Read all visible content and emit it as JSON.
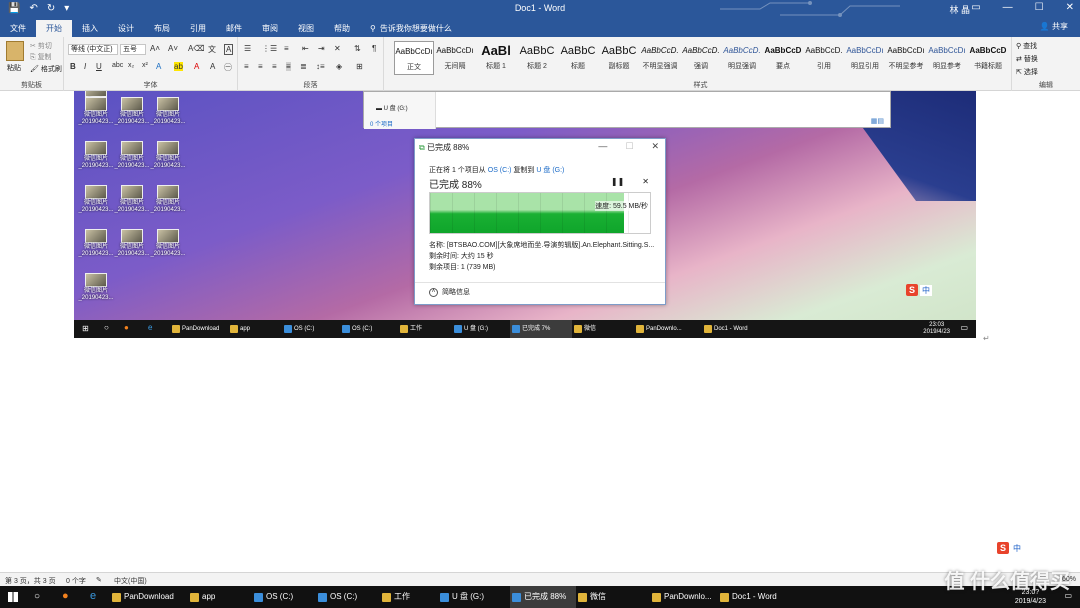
{
  "window": {
    "doc_title": "Doc1 - Word",
    "user": "林 晶",
    "share_label": "共享",
    "tell_me_placeholder": "告诉我你想要做什么"
  },
  "tabs": [
    "文件",
    "开始",
    "插入",
    "设计",
    "布局",
    "引用",
    "邮件",
    "审阅",
    "视图",
    "帮助"
  ],
  "ribbon": {
    "clipboard": {
      "paste": "粘贴",
      "cut": "剪切",
      "copy": "复制",
      "format_painter": "格式刷",
      "label": "剪贴板"
    },
    "font": {
      "name": "等线 (中文正)",
      "size": "五号",
      "label": "字体"
    },
    "paragraph": {
      "label": "段落"
    },
    "styles": {
      "label": "样式",
      "items": [
        {
          "sample": "AaBbCcDı",
          "name": "正文"
        },
        {
          "sample": "AaBbCcDı",
          "name": "无间隔"
        },
        {
          "sample": "AaBl",
          "name": "标题 1"
        },
        {
          "sample": "AaBbC",
          "name": "标题 2"
        },
        {
          "sample": "AaBbC",
          "name": "标题"
        },
        {
          "sample": "AaBbC",
          "name": "副标题"
        },
        {
          "sample": "AaBbCcD.",
          "name": "不明显强调"
        },
        {
          "sample": "AaBbCcD.",
          "name": "强调"
        },
        {
          "sample": "AaBbCcD.",
          "name": "明显强调"
        },
        {
          "sample": "AaBbCcD",
          "name": "要点"
        },
        {
          "sample": "AaBbCcD.",
          "name": "引用"
        },
        {
          "sample": "AaBbCcDı",
          "name": "明显引用"
        },
        {
          "sample": "AaBbCcDı",
          "name": "不明显参考"
        },
        {
          "sample": "AaBbCcDı",
          "name": "明显参考"
        },
        {
          "sample": "AaBbCcD",
          "name": "书籍标题"
        }
      ]
    },
    "editing": {
      "find": "查找",
      "replace": "替换",
      "select": "选择",
      "label": "编辑"
    }
  },
  "screenshot": {
    "desktop_icons": [
      "Sports",
      "微信图片_20190423...",
      "微信图片_20190423...",
      "微信图片_20190423...",
      "微信图片_20190423...",
      "微信图片_20190423...",
      "微信图片_20190423...",
      "微信图片_20190423...",
      "微信图片_20190423...",
      "微信图片_20190423...",
      "微信图片_20190423...",
      "微信图片_20190423...",
      "微信图片_20190423...",
      "微信图片_20190423..."
    ],
    "explorer": {
      "drive": "U 盘 (G:)",
      "count": "0 个项目"
    },
    "copy_dialog": {
      "title": "已完成 88%",
      "line_prefix": "正在将 1 个项目从",
      "source": "OS (C:)",
      "line_mid": "复制到",
      "dest": "U 盘 (G:)",
      "progress_text": "已完成 88%",
      "progress": 0.88,
      "speed": "速度: 59.5 MB/秒",
      "name": "名称: [BTSBAO.COM][大象席地而坐.导演剪辑版].An.Elephant.Sitting.S...",
      "remaining_time": "剩余时间: 大约 15 秒",
      "remaining_items": "剩余项目: 1 (739 MB)",
      "less_info": "简略信息"
    },
    "ime": {
      "s": "S",
      "c": "中"
    },
    "taskbar": {
      "items": [
        "PanDownload",
        "app",
        "OS (C:)",
        "OS (C:)",
        "工作",
        "U 盘 (G:)",
        "已完成 7%",
        "微信",
        "PanDownlo...",
        "Doc1 - Word"
      ],
      "time": "23:03",
      "date": "2019/4/23"
    }
  },
  "statusbar": {
    "pages": "第 3 页，共 3 页",
    "words": "0 个字",
    "lang": "中文(中国)",
    "zoom": "60%"
  },
  "taskbar": {
    "items": [
      "PanDownload",
      "app",
      "OS (C:)",
      "OS (C:)",
      "工作",
      "U 盘 (G:)",
      "已完成 88%",
      "微信",
      "PanDownlo...",
      "Doc1 - Word"
    ],
    "time": "23:0?",
    "date": "2019/4/23"
  },
  "watermark": "值 什么值得买"
}
